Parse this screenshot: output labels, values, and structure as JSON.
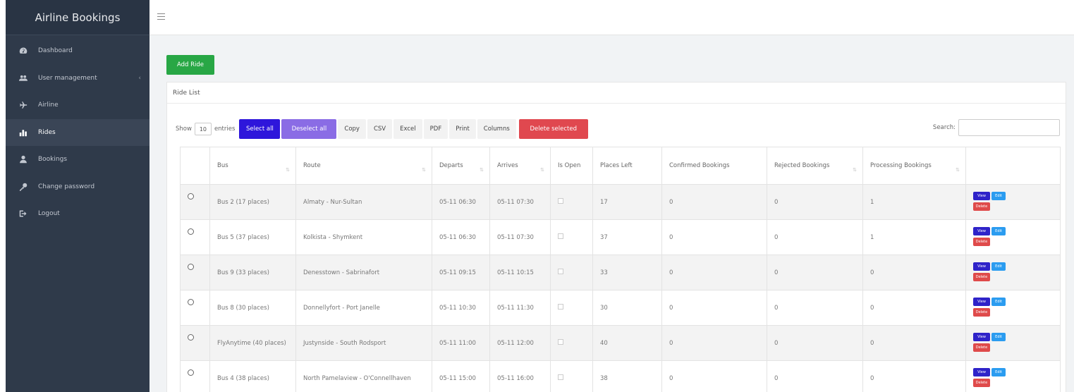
{
  "sidebar": {
    "brand": "Airline Bookings",
    "items": [
      {
        "label": "Dashboard",
        "icon": "dashboard-icon"
      },
      {
        "label": "User management",
        "icon": "users-icon",
        "has_submenu": true
      },
      {
        "label": "Airline",
        "icon": "plane-icon"
      },
      {
        "label": "Rides",
        "icon": "chart-icon",
        "active": true
      },
      {
        "label": "Bookings",
        "icon": "user-icon"
      },
      {
        "label": "Change password",
        "icon": "key-icon"
      },
      {
        "label": "Logout",
        "icon": "logout-icon"
      }
    ]
  },
  "main": {
    "add_button": "Add Ride",
    "card_title": "Ride List",
    "toolbar": {
      "show_label": "Show",
      "entries_value": "10",
      "entries_label": "entries",
      "select_all": "Select all",
      "deselect_all": "Deselect all",
      "copy": "Copy",
      "csv": "CSV",
      "excel": "Excel",
      "pdf": "PDF",
      "print": "Print",
      "columns": "Columns",
      "delete_selected": "Delete selected"
    },
    "search_label": "Search:",
    "search_value": "",
    "table": {
      "columns": [
        "",
        "Bus",
        "Route",
        "Departs",
        "Arrives",
        "Is Open",
        "Places Left",
        "Confirmed Bookings",
        "Rejected Bookings",
        "Processing Bookings",
        ""
      ],
      "rows": [
        {
          "bus": "Bus 2 (17 places)",
          "route": "Almaty - Nur-Sultan",
          "departs": "05-11 06:30",
          "arrives": "05-11 07:30",
          "places_left": "17",
          "confirmed": "0",
          "rejected": "0",
          "processing": "1"
        },
        {
          "bus": "Bus 5 (37 places)",
          "route": "Kolkista - Shymkent",
          "departs": "05-11 06:30",
          "arrives": "05-11 07:30",
          "places_left": "37",
          "confirmed": "0",
          "rejected": "0",
          "processing": "1"
        },
        {
          "bus": "Bus 9 (33 places)",
          "route": "Denesstown - Sabrinafort",
          "departs": "05-11 09:15",
          "arrives": "05-11 10:15",
          "places_left": "33",
          "confirmed": "0",
          "rejected": "0",
          "processing": "0"
        },
        {
          "bus": "Bus 8 (30 places)",
          "route": "Donnellyfort - Port Janelle",
          "departs": "05-11 10:30",
          "arrives": "05-11 11:30",
          "places_left": "30",
          "confirmed": "0",
          "rejected": "0",
          "processing": "0"
        },
        {
          "bus": "FlyAnytime (40 places)",
          "route": "Justynside - South Rodsport",
          "departs": "05-11 11:00",
          "arrives": "05-11 12:00",
          "places_left": "40",
          "confirmed": "0",
          "rejected": "0",
          "processing": "0"
        },
        {
          "bus": "Bus 4 (38 places)",
          "route": "North Pamelaview - O'Connellhaven",
          "departs": "05-11 15:00",
          "arrives": "05-11 16:00",
          "places_left": "38",
          "confirmed": "0",
          "rejected": "0",
          "processing": "0"
        }
      ],
      "row_actions": {
        "view": "View",
        "edit": "Edit",
        "delete": "Delete"
      }
    }
  },
  "colors": {
    "sidebar_bg": "#2f3a4a",
    "add_button": "#28a745",
    "select_all": "#2e16db",
    "deselect_all": "#8a6ce5",
    "delete": "#e0484f",
    "view": "#2f23c9",
    "edit": "#2b9cf0"
  }
}
